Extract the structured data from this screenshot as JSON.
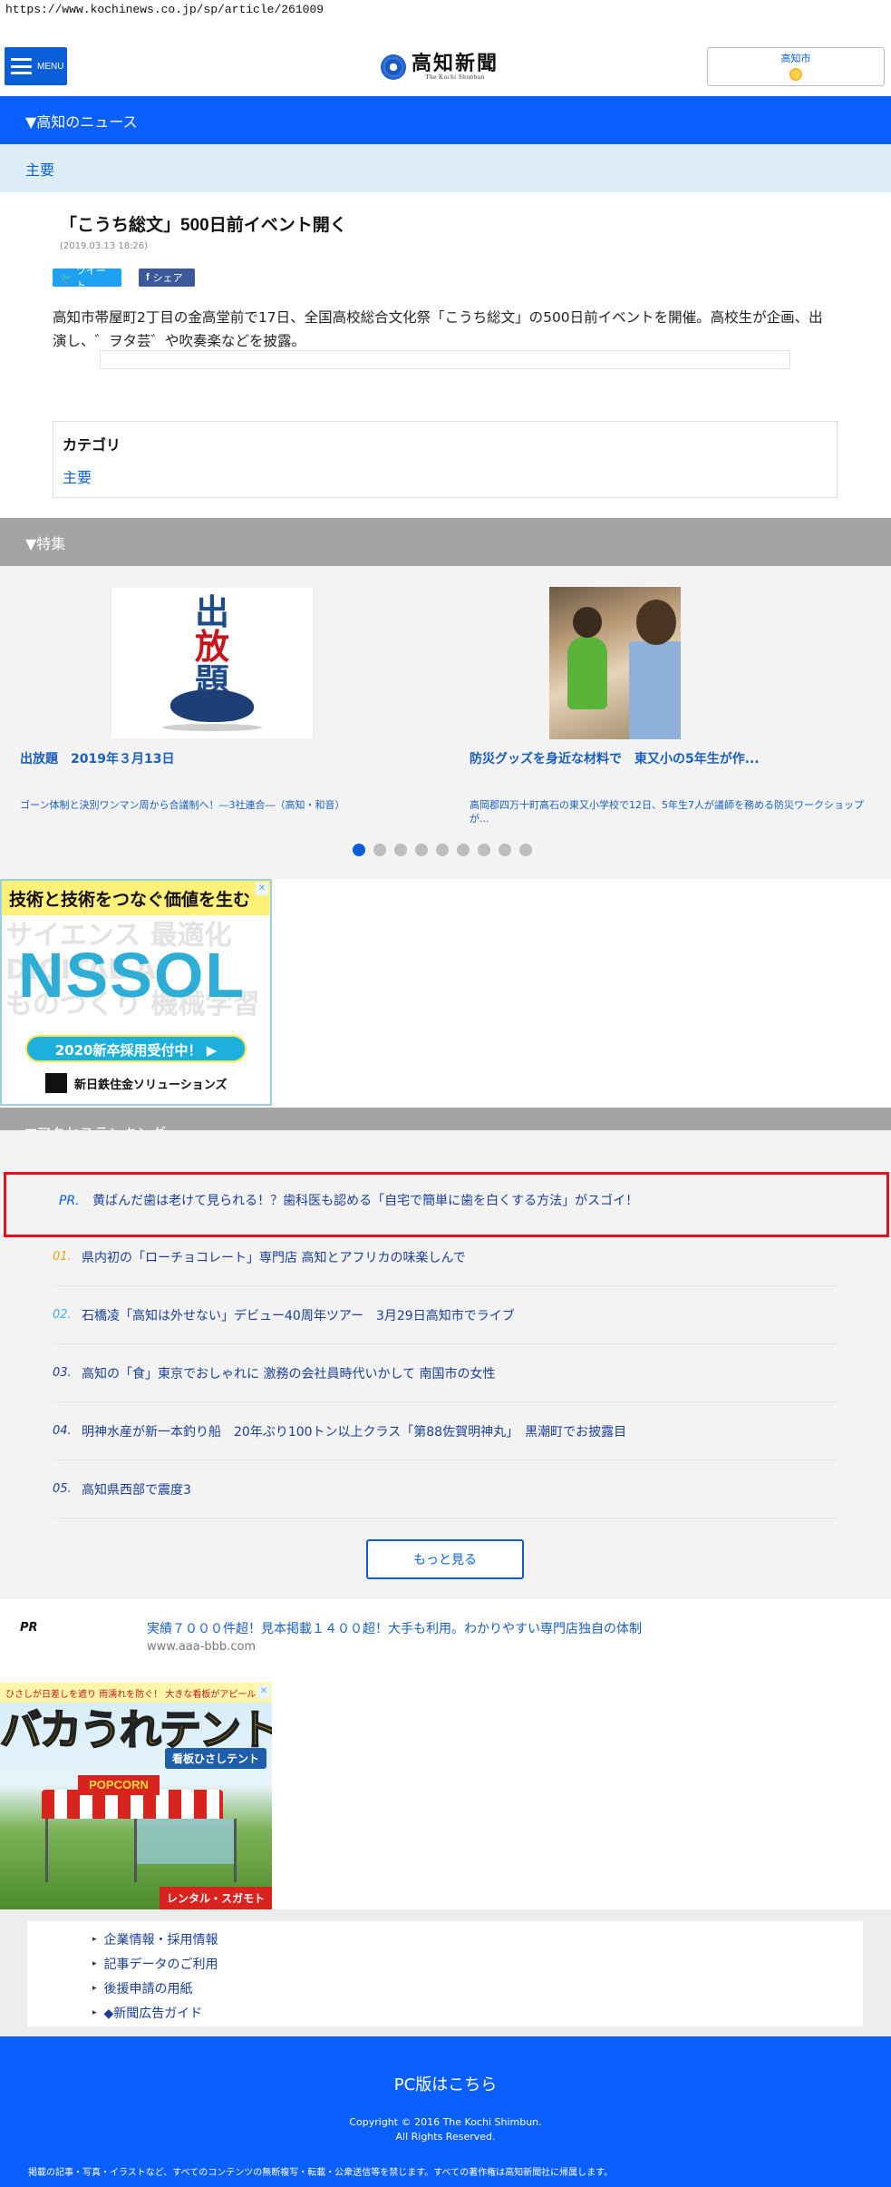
{
  "browser": {
    "url": "https://www.kochinews.co.jp/sp/article/261009"
  },
  "header": {
    "menu_label": "MENU",
    "logo_main": "高知新聞",
    "logo_sub": "The Kochi Shimbun",
    "weather_city": "高知市"
  },
  "section_news": "▼高知のニュース",
  "sub_category": "主要",
  "article": {
    "title": "「こうち総文」500日前イベント開く",
    "date": "(2019.03.13 18:26)",
    "tweet_label": "ツイート",
    "share_label": "シェア",
    "body": "高知市帯屋町2丁目の金高堂前で17日、全国高校総合文化祭「こうち総文」の500日前イベントを開催。高校生が企画、出演し、゛ヲタ芸゛や吹奏楽などを披露。"
  },
  "category_box": {
    "heading": "カテゴリ",
    "link": "主要"
  },
  "section_feature": "▼特集",
  "features": [
    {
      "image_chars": [
        "出",
        "放",
        "題"
      ],
      "title": "出放題　2019年３月13日",
      "desc": "ゴーン体制と決別ワンマン周から合議制へ！―3社連合―（高知・和音）"
    },
    {
      "title": "防災グッズを身近な材料で　東又小の5年生が作...",
      "desc": "高岡郡四万十町高石の東又小学校で12日、5年生7人が議師を務める防災ワークショップが..."
    }
  ],
  "carousel": {
    "count": 9,
    "active": 0
  },
  "ad1": {
    "headline": "技術と技術をつなぐ価値を生む",
    "bg_words": [
      "サイエンス 最適化",
      "DIGITAL AI",
      "ものづくり 機械学習"
    ],
    "brand": "NSSOL",
    "pill": "2020新卒採用受付中！ ▶",
    "company": "新日鉄住金ソリューションズ",
    "close": "✕"
  },
  "section_ranking": "▼アクセスランキング",
  "ranking": {
    "pr": {
      "no": "PR.",
      "title": "黄ばんだ歯は老けて見られる！？歯科医も認める「自宅で簡単に歯を白くする方法」がスゴイ！"
    },
    "items": [
      {
        "no": "01.",
        "color": "#e8a21b",
        "title": "県内初の「ローチョコレート」専門店 高知とアフリカの味楽しんで"
      },
      {
        "no": "02.",
        "color": "#4aa9e6",
        "title": "石橋凌「高知は外せない」デビュー40周年ツアー　3月29日高知市でライブ"
      },
      {
        "no": "03.",
        "color": "#1a3e9a",
        "title": "高知の「食」東京でおしゃれに 激務の会社員時代いかして 南国市の女性"
      },
      {
        "no": "04.",
        "color": "#1a3e9a",
        "title": "明神水産が新一本釣り船　20年ぶり100トン以上クラス「第88佐賀明神丸」　黒潮町でお披露目"
      },
      {
        "no": "05.",
        "color": "#1a3e9a",
        "title": "高知県西部で震度3"
      }
    ],
    "more_label": "もっと見る"
  },
  "pr_text_ad": {
    "label": "PR",
    "title": "実績７０００件超！見本掲載１４００超！大手も利用。わかりやすい専門店独自の体制",
    "url": "www.aaa-bbb.com"
  },
  "ad2": {
    "top_text": "ひさしが日差しを遮り 雨濡れを防ぐ！ 大きな看板がアピール！！",
    "title": "バカうれテント",
    "tag": "看板ひさしテント",
    "sign": "POPCORN",
    "brand": "レンタル・スガモト"
  },
  "footer_links": [
    "企業情報・採用情報",
    "記事データのご利用",
    "後援申請の用紙",
    "◆新聞広告ガイド"
  ],
  "footer": {
    "pc_link": "PC版はこちら",
    "copyright": "Copyright © 2016 The Kochi Shimbun.",
    "rights": "All Rights Reserved.",
    "notice": "掲載の記事・写真・イラストなど、すべてのコンテンツの無断複写・転載・公衆送信等を禁じます。すべての著作権は高知新聞社に帰属します。"
  }
}
